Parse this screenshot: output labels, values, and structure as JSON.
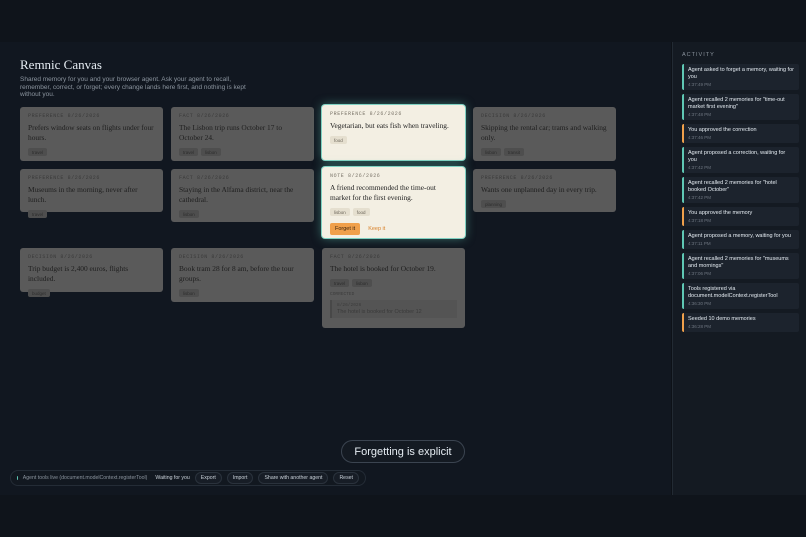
{
  "app": {
    "title": "Remnic Canvas",
    "subtitle": "Shared memory for you and your browser agent. Ask your agent to recall, remember, correct, or forget; every change lands here first, and nothing is kept without you."
  },
  "cards": [
    {
      "id": "c1",
      "meta": "PREFERENCE 8/26/2026",
      "text": "Prefers window seats on flights under four hours.",
      "tags": [
        "travel"
      ]
    },
    {
      "id": "c2",
      "meta": "FACT 8/26/2026",
      "text": "The Lisbon trip runs October 17 to October 24.",
      "tags": [
        "travel",
        "lisbon"
      ]
    },
    {
      "id": "c3",
      "meta": "PREFERENCE 8/26/2026",
      "text": "Vegetarian, but eats fish when traveling.",
      "tags": [
        "food"
      ]
    },
    {
      "id": "c4",
      "meta": "DECISION 8/26/2026",
      "text": "Skipping the rental car; trams and walking only.",
      "tags": [
        "lisbon",
        "transit"
      ]
    },
    {
      "id": "c5",
      "meta": "PREFERENCE 8/26/2026",
      "text": "Museums in the morning, never after lunch.",
      "tags": [
        "travel"
      ]
    },
    {
      "id": "c6",
      "meta": "FACT 8/26/2026",
      "text": "Staying in the Alfama district, near the cathedral.",
      "tags": [
        "lisbon"
      ]
    },
    {
      "id": "c7",
      "meta": "NOTE 8/26/2026",
      "text": "A friend recommended the time-out market for the first evening.",
      "tags": [
        "lisbon",
        "food"
      ],
      "actions": {
        "forget": "Forget it",
        "keep": "Keep it"
      }
    },
    {
      "id": "c8",
      "meta": "PREFERENCE 8/26/2026",
      "text": "Wants one unplanned day in every trip.",
      "tags": [
        "planning"
      ]
    },
    {
      "id": "c9",
      "meta": "DECISION 8/26/2026",
      "text": "Trip budget is 2,400 euros, flights included.",
      "tags": [
        "budget"
      ]
    },
    {
      "id": "c10",
      "meta": "DECISION 8/26/2026",
      "text": "Book tram 28 for 8 am, before the tour groups.",
      "tags": [
        "lisbon"
      ]
    },
    {
      "id": "c11",
      "meta": "FACT 8/26/2026",
      "text": "The hotel is booked for October 19.",
      "tags": [
        "travel",
        "lisbon"
      ],
      "correction": {
        "label": "CORRECTED",
        "meta": "8/26/2026",
        "text": "The hotel is booked for October 12"
      }
    }
  ],
  "toast": "Forgetting is explicit",
  "statusbar": {
    "live": "Agent tools live (document.modelContext.registerTool)",
    "waiting": "Waiting for you",
    "buttons": {
      "export": "Export",
      "import": "Import",
      "share": "Share with another agent",
      "reset": "Reset"
    }
  },
  "activity": {
    "title": "ACTIVITY",
    "items": [
      {
        "text": "Agent asked to forget a memory, waiting for you",
        "time": "4:37:49 PM",
        "kind": "agent"
      },
      {
        "text": "Agent recalled 2 memories for \"time-out market first evening\"",
        "time": "4:37:48 PM",
        "kind": "agent"
      },
      {
        "text": "You approved the correction",
        "time": "4:37:46 PM",
        "kind": "human"
      },
      {
        "text": "Agent proposed a correction, waiting for you",
        "time": "4:37:42 PM",
        "kind": "agent"
      },
      {
        "text": "Agent recalled 2 memories for \"hotel booked October\"",
        "time": "4:37:42 PM",
        "kind": "agent"
      },
      {
        "text": "You approved the memory",
        "time": "4:37:18 PM",
        "kind": "human"
      },
      {
        "text": "Agent proposed a memory, waiting for you",
        "time": "4:37:11 PM",
        "kind": "agent"
      },
      {
        "text": "Agent recalled 2 memories for \"museums and mornings\"",
        "time": "4:37:06 PM",
        "kind": "agent"
      },
      {
        "text": "Tools registered via document.modelContext.registerTool",
        "time": "4:36:30 PM",
        "kind": "agent"
      },
      {
        "text": "Seeded 10 demo memories",
        "time": "4:36:28 PM",
        "kind": "human"
      }
    ]
  }
}
